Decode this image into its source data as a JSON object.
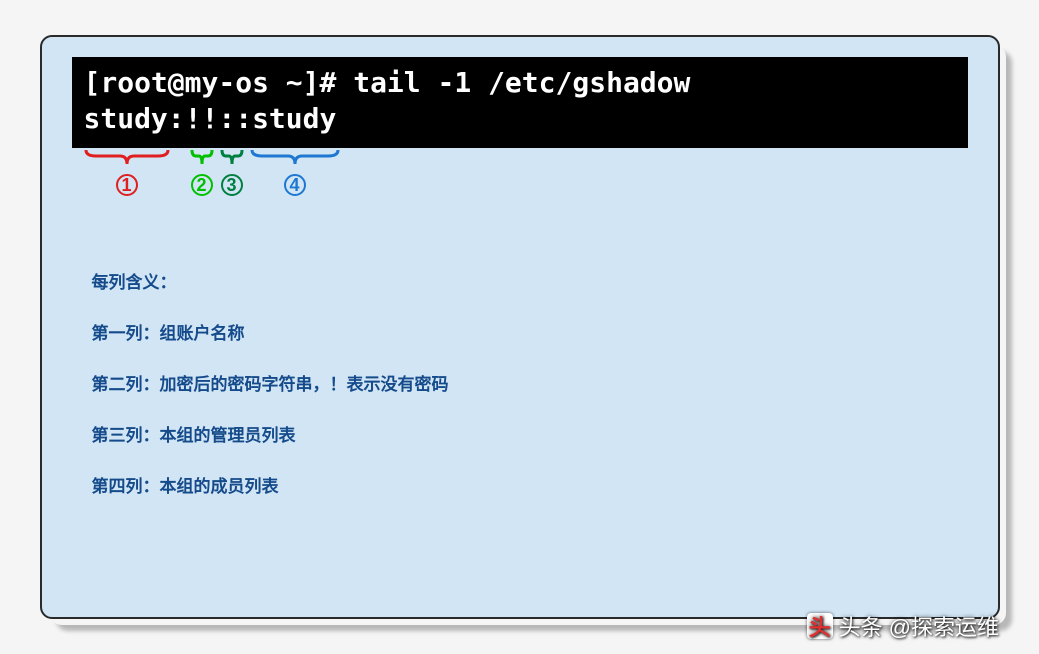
{
  "terminal": {
    "line1": "[root@my-os ~]# tail -1 /etc/gshadow",
    "line2": "study:!!::study"
  },
  "brackets": {
    "b1_num": "1",
    "b2_num": "2",
    "b3_num": "3",
    "b4_num": "4"
  },
  "content": {
    "heading": "每列含义：",
    "col1": "第一列：组账户名称",
    "col2": "第二列：加密后的密码字符串，！表示没有密码",
    "col3": "第三列：本组的管理员列表",
    "col4": "第四列：本组的成员列表"
  },
  "watermark": {
    "prefix": "头条",
    "author": "@探索运维"
  }
}
